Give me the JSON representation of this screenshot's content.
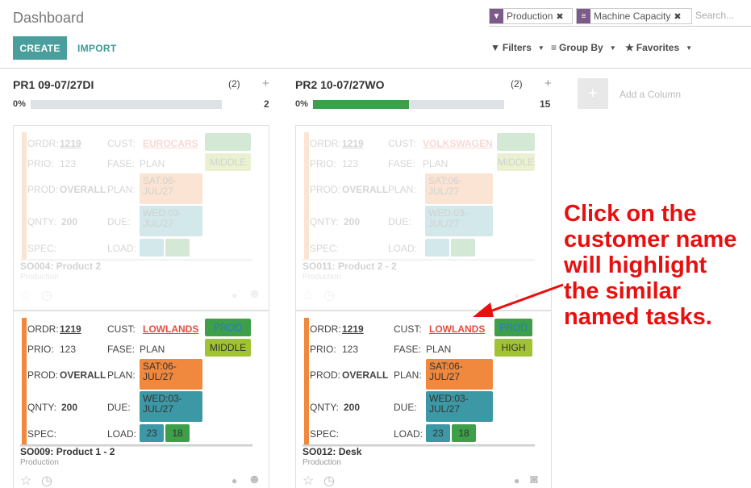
{
  "header": {
    "title": "Dashboard",
    "create_label": "CREATE",
    "import_label": "IMPORT"
  },
  "search": {
    "facets": [
      {
        "icon": "filter-icon",
        "label": "Production"
      },
      {
        "icon": "group-icon",
        "label": "Machine Capacity"
      }
    ],
    "placeholder": "Search..."
  },
  "menus": {
    "filters": "Filters",
    "group_by": "Group By",
    "favorites": "Favorites"
  },
  "columns": [
    {
      "title": "PR1 09-07/27DI",
      "count": "(2)",
      "pct": "0%",
      "progress": 0,
      "total": "2",
      "cards": [
        {
          "faded": true,
          "ordr_label": "ORDR:",
          "ordr": "1219",
          "cust_label": "CUST:",
          "cust": "EUROCARS",
          "prio_label": "PRIO:",
          "prio": "123",
          "fase_label": "FASE:",
          "fase": "PLAN",
          "stage_badge": "",
          "fase_badge": "MIDDLE",
          "prod_label": "PROD:",
          "prod": "OVERALL",
          "plan_label": "PLAN:",
          "plan": "SAT:06-JUL/27",
          "qnty_label": "QNTY:",
          "qnty": "200",
          "due_label": "DUE:",
          "due": "WED:03-JUL/27",
          "spec_label": "SPEC:",
          "load_label": "LOAD:",
          "load_a": "",
          "load_b": "",
          "name": "SO004: Product 2",
          "sub": "Production"
        },
        {
          "faded": false,
          "ordr_label": "ORDR:",
          "ordr": "1219",
          "cust_label": "CUST:",
          "cust": "LOWLANDS",
          "prio_label": "PRIO:",
          "prio": "123",
          "fase_label": "FASE:",
          "fase": "PLAN",
          "stage_badge": "PROD",
          "fase_badge": "MIDDLE",
          "prod_label": "PROD:",
          "prod": "OVERALL",
          "plan_label": "PLAN:",
          "plan": "SAT:06-JUL/27",
          "qnty_label": "QNTY:",
          "qnty": "200",
          "due_label": "DUE:",
          "due": "WED:03-JUL/27",
          "spec_label": "SPEC:",
          "load_label": "LOAD:",
          "load_a": "23",
          "load_b": "18",
          "name": "SO009: Product 1 - 2",
          "sub": "Production"
        }
      ]
    },
    {
      "title": "PR2 10-07/27WO",
      "count": "(2)",
      "pct": "0%",
      "progress": 0.5,
      "total": "15",
      "cards": [
        {
          "faded": true,
          "ordr_label": "ORDR:",
          "ordr": "1219",
          "cust_label": "CUST:",
          "cust": "VOLKSWAGEN",
          "prio_label": "PRIO:",
          "prio": "123",
          "fase_label": "FASE:",
          "fase": "PLAN",
          "stage_badge": "",
          "fase_badge": "MIDDLE",
          "prod_label": "PROD:",
          "prod": "OVERALL",
          "plan_label": "PLAN:",
          "plan": "SAT:06-JUL/27",
          "qnty_label": "QNTY:",
          "qnty": "200",
          "due_label": "DUE:",
          "due": "WED:03-JUL/27",
          "spec_label": "SPEC:",
          "load_label": "LOAD:",
          "load_a": "",
          "load_b": "",
          "name": "SO011: Product 2 - 2",
          "sub": "Production"
        },
        {
          "faded": false,
          "ordr_label": "ORDR:",
          "ordr": "1219",
          "cust_label": "CUST:",
          "cust": "LOWLANDS",
          "prio_label": "PRIO:",
          "prio": "123",
          "fase_label": "FASE:",
          "fase": "PLAN",
          "stage_badge": "PROD",
          "fase_badge": "HIGH",
          "prod_label": "PROD:",
          "prod": "OVERALL",
          "plan_label": "PLAN:",
          "plan": "SAT:06-JUL/27",
          "qnty_label": "QNTY:",
          "qnty": "200",
          "due_label": "DUE:",
          "due": "WED:03-JUL/27",
          "spec_label": "SPEC:",
          "load_label": "LOAD:",
          "load_a": "23",
          "load_b": "18",
          "name": "SO012: Desk",
          "sub": "Production"
        }
      ]
    }
  ],
  "add_column": {
    "label": "Add a Column"
  },
  "annotation": {
    "text": "Click on the\ncustomer name\nwill highlight\nthe similar\nnamed tasks."
  },
  "colors": {
    "primary": "#4a9e9b",
    "annotation": "#e80f0f",
    "card_strip": "#f0883d",
    "progress": "#3d9f49"
  }
}
